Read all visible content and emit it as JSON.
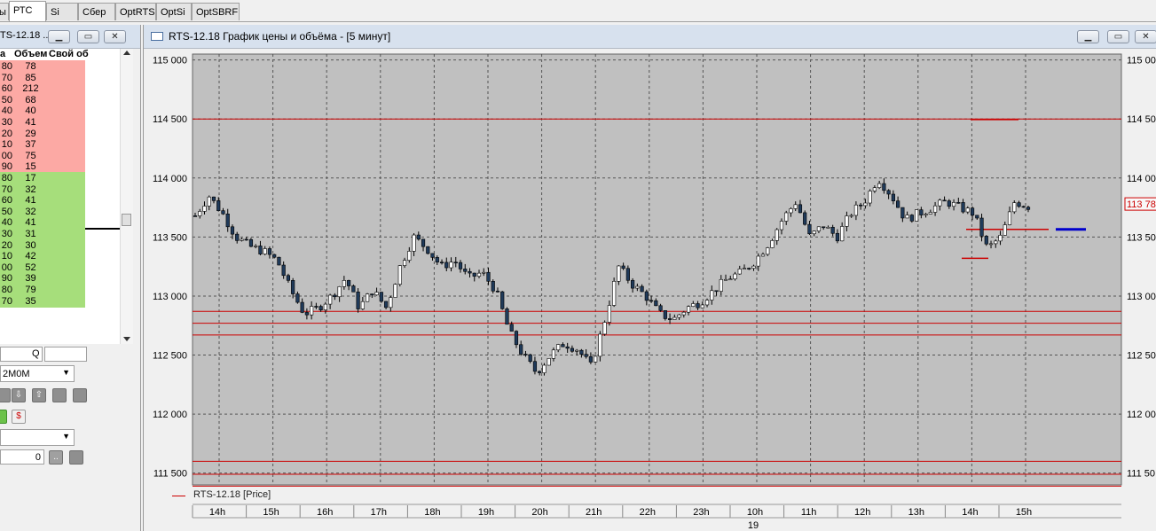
{
  "tabs": [
    {
      "label": "ы",
      "active": false
    },
    {
      "label": "РТС",
      "active": true
    },
    {
      "label": "Si",
      "active": false
    },
    {
      "label": "Сбер",
      "active": false
    },
    {
      "label": "OptRTS",
      "active": false
    },
    {
      "label": "OptSi",
      "active": false
    },
    {
      "label": "OptSBRF",
      "active": false
    }
  ],
  "orderbook": {
    "title": "TS-12.18 ...",
    "headers": {
      "price": "а",
      "volume": "Объем",
      "own": "Свой об"
    },
    "sell": [
      {
        "price": "80",
        "volume": "78"
      },
      {
        "price": "70",
        "volume": "85"
      },
      {
        "price": "60",
        "volume": "212"
      },
      {
        "price": "50",
        "volume": "68"
      },
      {
        "price": "40",
        "volume": "40"
      },
      {
        "price": "30",
        "volume": "41"
      },
      {
        "price": "20",
        "volume": "29"
      },
      {
        "price": "10",
        "volume": "37"
      },
      {
        "price": "00",
        "volume": "75"
      },
      {
        "price": "90",
        "volume": "15"
      }
    ],
    "buy": [
      {
        "price": "80",
        "volume": "17"
      },
      {
        "price": "70",
        "volume": "32"
      },
      {
        "price": "60",
        "volume": "41"
      },
      {
        "price": "50",
        "volume": "32"
      },
      {
        "price": "40",
        "volume": "41"
      },
      {
        "price": "30",
        "volume": "31"
      },
      {
        "price": "20",
        "volume": "30"
      },
      {
        "price": "10",
        "volume": "42"
      },
      {
        "price": "00",
        "volume": "52"
      },
      {
        "price": "90",
        "volume": "39"
      },
      {
        "price": "80",
        "volume": "79"
      },
      {
        "price": "70",
        "volume": "35"
      }
    ],
    "q_label": "Q",
    "account": "2M0M",
    "qty_value": "0"
  },
  "chart": {
    "title": "RTS-12.18 График цены и объёма - [5 минут]",
    "legend": "RTS-12.18 [Price]",
    "last_price_label": "113 78"
  },
  "chart_data": {
    "type": "candlestick",
    "y_axis_labels": [
      "115 000",
      "114 500",
      "114 000",
      "113 500",
      "113 000",
      "112 500",
      "112 000",
      "111 500"
    ],
    "y_axis_labels_right": [
      "115 00",
      "114 50",
      "114 00",
      "113 50",
      "113 00",
      "112 50",
      "112 00",
      "111 50"
    ],
    "ylim": [
      111400,
      115050
    ],
    "x_axis_labels": [
      "14h",
      "15h",
      "16h",
      "17h",
      "18h",
      "19h",
      "20h",
      "21h",
      "22h",
      "23h",
      "10h",
      "11h",
      "12h",
      "13h",
      "14h",
      "15h"
    ],
    "date_label": "19",
    "horizontal_levels": [
      114500,
      112870,
      112770,
      112670,
      111600,
      111490,
      111390
    ],
    "short_levels": [
      {
        "price": 114495,
        "color": "#cc0000"
      },
      {
        "price": 113565,
        "color": "#cc0000"
      },
      {
        "price": 113320,
        "color": "#cc0000"
      },
      {
        "price": 113565,
        "color": "#0000cc"
      }
    ],
    "price_path": [
      113680,
      113850,
      113700,
      113500,
      113420,
      113380,
      113300,
      113050,
      112850,
      112900,
      113000,
      113150,
      112900,
      113050,
      112900,
      113250,
      113500,
      113400,
      113250,
      113300,
      113150,
      113200,
      113050,
      112700,
      112500,
      112350,
      112500,
      112600,
      112550,
      112400,
      112800,
      113250,
      113100,
      113000,
      112850,
      112800,
      112900,
      112950,
      113050,
      113150,
      113200,
      113300,
      113450,
      113650,
      113800,
      113500,
      113600,
      113500,
      113700,
      113800,
      114000,
      113850,
      113650,
      113700,
      113750,
      113800,
      113750,
      113700,
      113400,
      113500,
      113800,
      113760
    ]
  }
}
